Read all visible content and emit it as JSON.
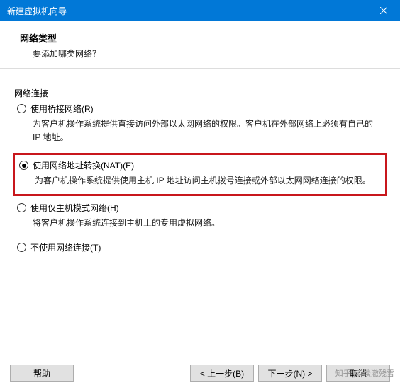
{
  "titlebar": {
    "title": "新建虚拟机向导"
  },
  "header": {
    "title": "网络类型",
    "subtitle": "要添加哪类网络？"
  },
  "fieldset": {
    "legend": "网络连接"
  },
  "options": [
    {
      "label": "使用桥接网络(R)",
      "desc": "为客户机操作系统提供直接访问外部以太网网络的权限。客户机在外部网络上必须有自己的 IP 地址。",
      "checked": false,
      "highlighted": false
    },
    {
      "label": "使用网络地址转换(NAT)(E)",
      "desc": "为客户机操作系统提供使用主机 IP 地址访问主机拨号连接或外部以太网网络连接的权限。",
      "checked": true,
      "highlighted": true
    },
    {
      "label": "使用仅主机模式网络(H)",
      "desc": "将客户机操作系统连接到主机上的专用虚拟网络。",
      "checked": false,
      "highlighted": false
    },
    {
      "label": "不使用网络连接(T)",
      "desc": "",
      "checked": false,
      "highlighted": false
    }
  ],
  "buttons": {
    "help": "帮助",
    "back": "< 上一步(B)",
    "next": "下一步(N) >",
    "cancel": "取消"
  },
  "watermark": "知乎 @ 琰澈残雪"
}
